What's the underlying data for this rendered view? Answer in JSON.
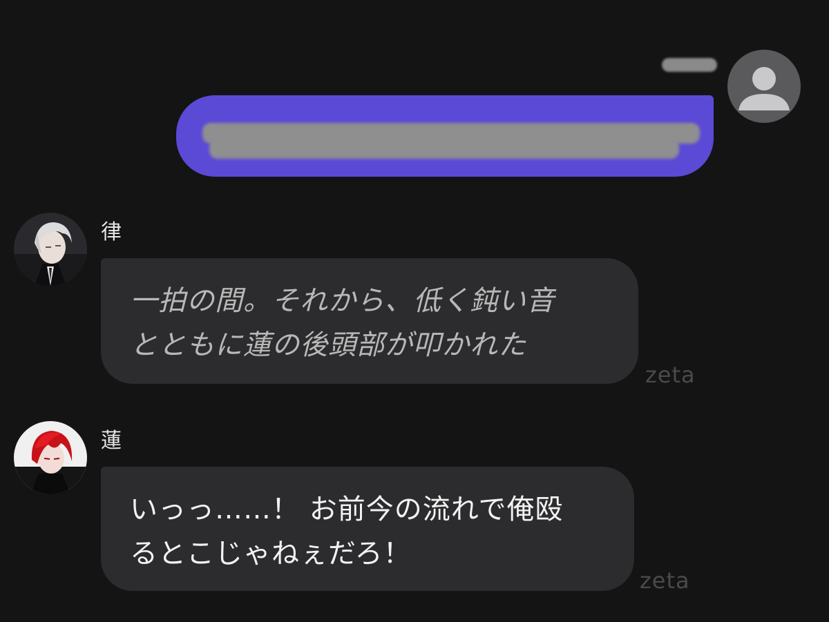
{
  "user_message": {
    "name_redacted": true,
    "text_redacted": true,
    "avatar": "default-user-avatar-icon",
    "bubble_color": "#5b4ad6"
  },
  "messages": [
    {
      "sender": "律",
      "avatar": "ritsu-avatar",
      "style": "narration",
      "lines": [
        "一拍の間。それから、低く鈍い音",
        "とともに蓮の後頭部が叩かれた"
      ],
      "watermark": "zeta"
    },
    {
      "sender": "蓮",
      "avatar": "ren-avatar",
      "style": "speech",
      "lines": [
        "いっっ……！ お前今の流れで俺殴",
        "るとこじゃねぇだろ！"
      ],
      "watermark": "zeta"
    }
  ],
  "colors": {
    "background": "#141414",
    "character_bubble": "#2c2c2e",
    "user_bubble": "#5b4ad6",
    "watermark": "#4a4a4a"
  }
}
